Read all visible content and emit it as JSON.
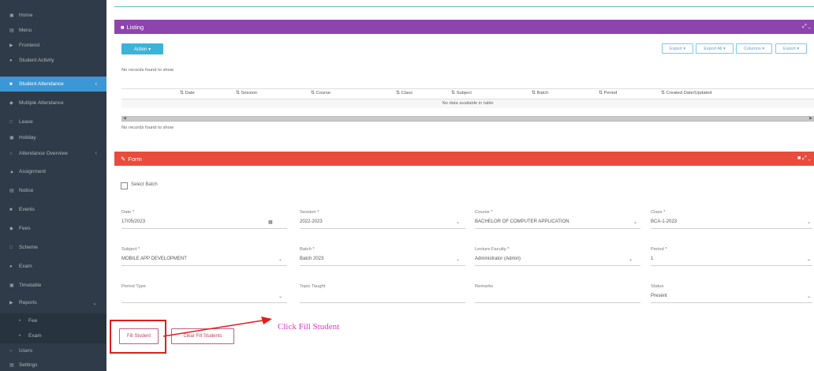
{
  "sidebar": {
    "items": [
      {
        "icon": "▣",
        "label": "Home"
      },
      {
        "icon": "▤",
        "label": "Menu"
      },
      {
        "icon": "▶",
        "label": "Frontend"
      },
      {
        "icon": "●",
        "label": "Student Activity"
      },
      {
        "icon": "■",
        "label": "Student Attendance"
      },
      {
        "icon": "◆",
        "label": "Multiple Attendance"
      },
      {
        "icon": "□",
        "label": "Leave"
      },
      {
        "icon": "▣",
        "label": "Holiday"
      },
      {
        "icon": "○",
        "label": "Attendance Overview"
      },
      {
        "icon": "▲",
        "label": "Assignment"
      },
      {
        "icon": "▤",
        "label": "Notice"
      },
      {
        "icon": "■",
        "label": "Events"
      },
      {
        "icon": "◆",
        "label": "Fees"
      },
      {
        "icon": "□",
        "label": "Scheme"
      },
      {
        "icon": "●",
        "label": "Exam"
      },
      {
        "icon": "▣",
        "label": "Timetable"
      },
      {
        "icon": "▶",
        "label": "Reports"
      },
      {
        "icon": "•",
        "label": "Fee"
      },
      {
        "icon": "•",
        "label": "Exam"
      },
      {
        "icon": "○",
        "label": "Users"
      },
      {
        "icon": "▤",
        "label": "Settings"
      }
    ]
  },
  "listing": {
    "title": "Listing",
    "action_label": "Action ▾",
    "export_buttons": [
      "Export ▾",
      "Export All ▾",
      "Columns ▾",
      "Export ▾"
    ],
    "records_top": "No records found to show",
    "records_bottom": "No records found to show",
    "columns": [
      "Date",
      "Session",
      "Course",
      "Class",
      "Subject",
      "Batch",
      "Period",
      "Created Date/Updated"
    ],
    "empty_text": "No data available in table"
  },
  "form": {
    "title": "Form",
    "checkbox_label": "Select Batch",
    "fields": [
      {
        "label": "Date *",
        "value": "17/05/2023"
      },
      {
        "label": "Session *",
        "value": "2022-2023"
      },
      {
        "label": "Course *",
        "value": "BACHELOR OF COMPUTER APPLICATION"
      },
      {
        "label": "Class *",
        "value": "BCA-1-2023"
      },
      {
        "label": "Subject *",
        "value": "MOBILE APP DEVELOPMENT"
      },
      {
        "label": "Batch *",
        "value": "Batch 2023"
      },
      {
        "label": "Lecture Faculty *",
        "value": "Administrator (Admin)"
      },
      {
        "label": "Period *",
        "value": "1"
      },
      {
        "label": "Period Type",
        "value": ""
      },
      {
        "label": "Topic Taught",
        "value": ""
      },
      {
        "label": "Remarks",
        "value": ""
      },
      {
        "label": "Status",
        "value": "Present"
      }
    ],
    "fill_button": "Fill Student",
    "clear_button": "Clear Fill Students"
  },
  "annotation": "Click Fill Student",
  "colors": {
    "sidebar": "#2f3b48",
    "sidebar_active": "#3c97d6",
    "listing_header": "#8e44ad",
    "form_header": "#e74c3c",
    "annotation": "#e636c8",
    "highlight": "#e21d1d"
  }
}
